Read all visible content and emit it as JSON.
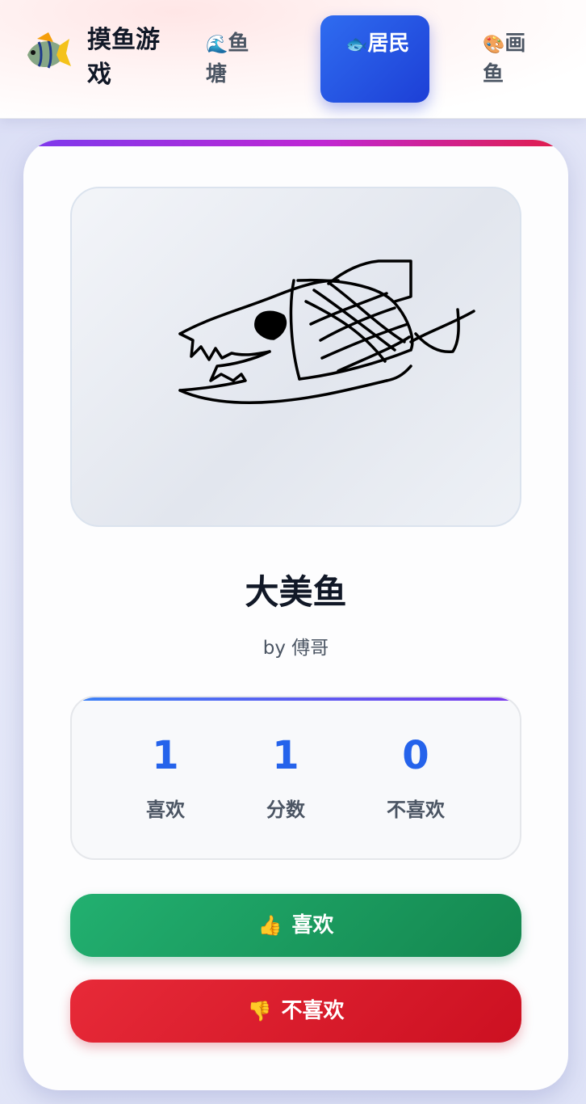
{
  "header": {
    "logo_icon": "tropical-fish-icon",
    "title": "摸鱼游戏",
    "nav": [
      {
        "icon": "🌊",
        "icon_name": "wave-icon",
        "label": "鱼塘",
        "active": false
      },
      {
        "icon": "🐟",
        "icon_name": "fish-icon",
        "label": "居民",
        "active": true
      },
      {
        "icon": "🎨",
        "icon_name": "palette-icon",
        "label": "画鱼",
        "active": false
      }
    ],
    "active_color": "#2563eb"
  },
  "fish": {
    "name": "大美鱼",
    "author": "by 傅哥"
  },
  "stats": [
    {
      "value": "1",
      "label": "喜欢"
    },
    {
      "value": "1",
      "label": "分数"
    },
    {
      "value": "0",
      "label": "不喜欢"
    }
  ],
  "actions": {
    "like_icon": "👍",
    "like_label": "喜欢",
    "like_color": "#16a34a",
    "dislike_icon": "👎",
    "dislike_label": "不喜欢",
    "dislike_color": "#dc2626"
  }
}
